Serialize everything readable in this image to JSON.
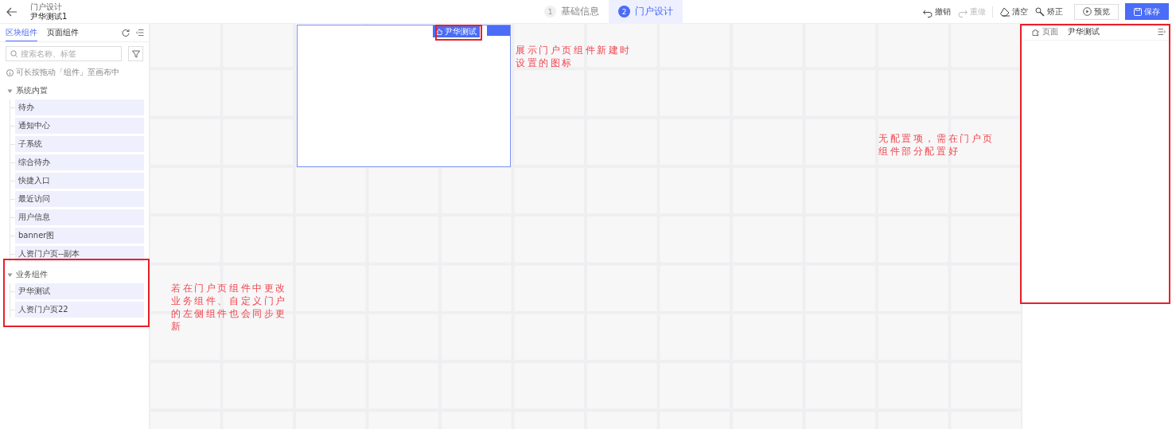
{
  "header": {
    "breadcrumb": "门户设计",
    "title": "尹华测试1"
  },
  "steps": [
    {
      "number": "1",
      "label": "基础信息",
      "selected": false
    },
    {
      "number": "2",
      "label": "门户设计",
      "selected": true
    }
  ],
  "toolbar": {
    "actions": [
      {
        "kind": "undo",
        "label": "撤销",
        "disabled": false
      },
      {
        "kind": "redo",
        "label": "重做",
        "disabled": true
      },
      {
        "kind": "clear",
        "label": "清空",
        "disabled": false
      },
      {
        "kind": "fix",
        "label": "矫正",
        "disabled": false
      }
    ],
    "preview": "预览",
    "save": "保存"
  },
  "left_panel": {
    "tabs": [
      {
        "label": "区块组件",
        "selected": true
      },
      {
        "label": "页面组件",
        "selected": false
      }
    ],
    "search": {
      "placeholder": "搜索名称、标签"
    },
    "hint": "可长按拖动「组件」至画布中",
    "groups": [
      {
        "label": "系统内置",
        "expanded": true,
        "children": [
          {
            "label": "待办"
          },
          {
            "label": "通知中心"
          },
          {
            "label": "子系统"
          },
          {
            "label": "综合待办"
          },
          {
            "label": "快捷入口"
          },
          {
            "label": "最近访问"
          },
          {
            "label": "用户信息"
          },
          {
            "label": "banner图"
          },
          {
            "label": "人资门户页--副本"
          }
        ]
      },
      {
        "label": "业务组件",
        "expanded": true,
        "children": [
          {
            "label": "尹华测试"
          },
          {
            "label": "人资门户页22"
          }
        ]
      }
    ]
  },
  "canvas": {
    "widget": {
      "tag": "尹华测试"
    }
  },
  "right_panel": {
    "tabs": [
      {
        "label": "页面",
        "selected": false
      },
      {
        "label": "尹华测试",
        "selected": true
      }
    ]
  },
  "annotations": [
    {
      "text": "展示门户页组件新建时设置的图标"
    },
    {
      "text": "无配置项，需在门户页组件部分配置好"
    },
    {
      "text": "若在门户页组件中更改业务组件、自定义门户的左侧组件也会同步更新"
    }
  ]
}
